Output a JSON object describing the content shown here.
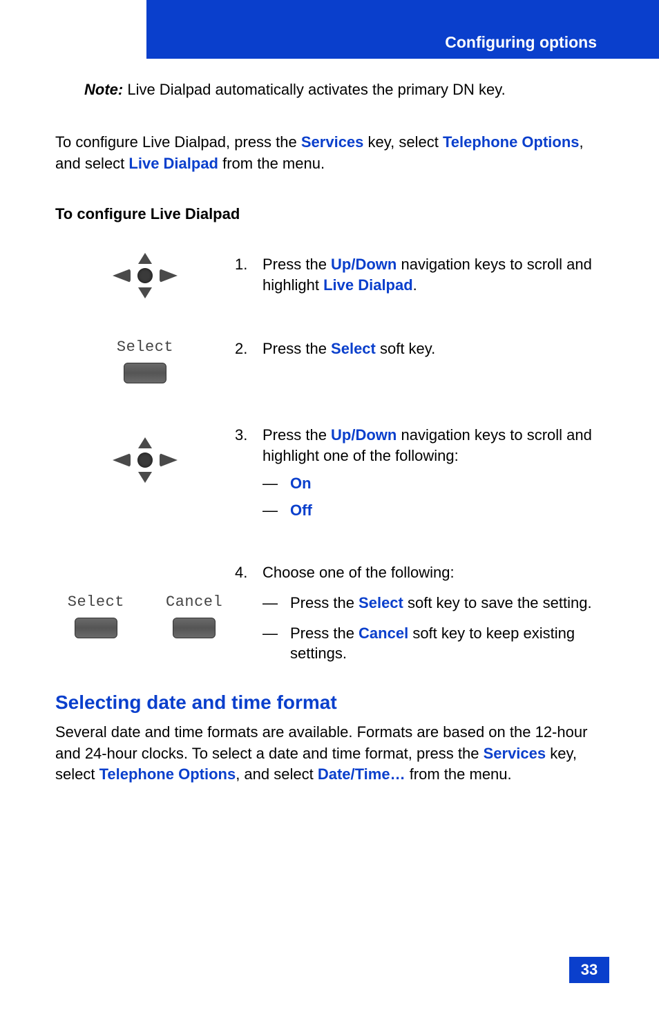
{
  "header": {
    "title": "Configuring options"
  },
  "note": {
    "label": "Note:",
    "text": " Live Dialpad automatically activates the primary DN key."
  },
  "intro": {
    "parts": [
      "To configure Live Dialpad, press the ",
      "Services",
      " key, select ",
      "Telephone Options",
      ", and select ",
      "Live Dialpad",
      " from the menu."
    ]
  },
  "sub_head": "To configure Live Dialpad",
  "softkey_labels": {
    "select": "Select",
    "cancel": "Cancel"
  },
  "steps": {
    "s1": {
      "num": "1.",
      "parts": [
        "Press the ",
        "Up/Down",
        " navigation keys to scroll and highlight ",
        "Live Dialpad",
        "."
      ]
    },
    "s2": {
      "num": "2.",
      "parts": [
        "Press the ",
        "Select",
        " soft key."
      ]
    },
    "s3": {
      "num": "3.",
      "parts": [
        "Press the ",
        "Up/Down",
        " navigation keys to scroll and highlight one of the following:"
      ],
      "opts": {
        "dash": "—",
        "on": "On",
        "off": "Off"
      }
    },
    "s4": {
      "num": "4.",
      "lead": "Choose one of the following:",
      "a": {
        "dash": "—",
        "parts": [
          "Press the ",
          "Select",
          " soft key to save the setting."
        ]
      },
      "b": {
        "dash": "—",
        "parts": [
          "Press the ",
          "Cancel",
          " soft key to keep existing settings."
        ]
      }
    }
  },
  "section": {
    "title": "Selecting date and time format",
    "parts": [
      "Several date and time formats are available. Formats are based on the 12-hour and 24-hour clocks. To select a date and time format, press the ",
      "Services",
      " key, select ",
      "Telephone Options",
      ", and select ",
      "Date/Time…",
      " from the menu."
    ]
  },
  "page_number": "33"
}
